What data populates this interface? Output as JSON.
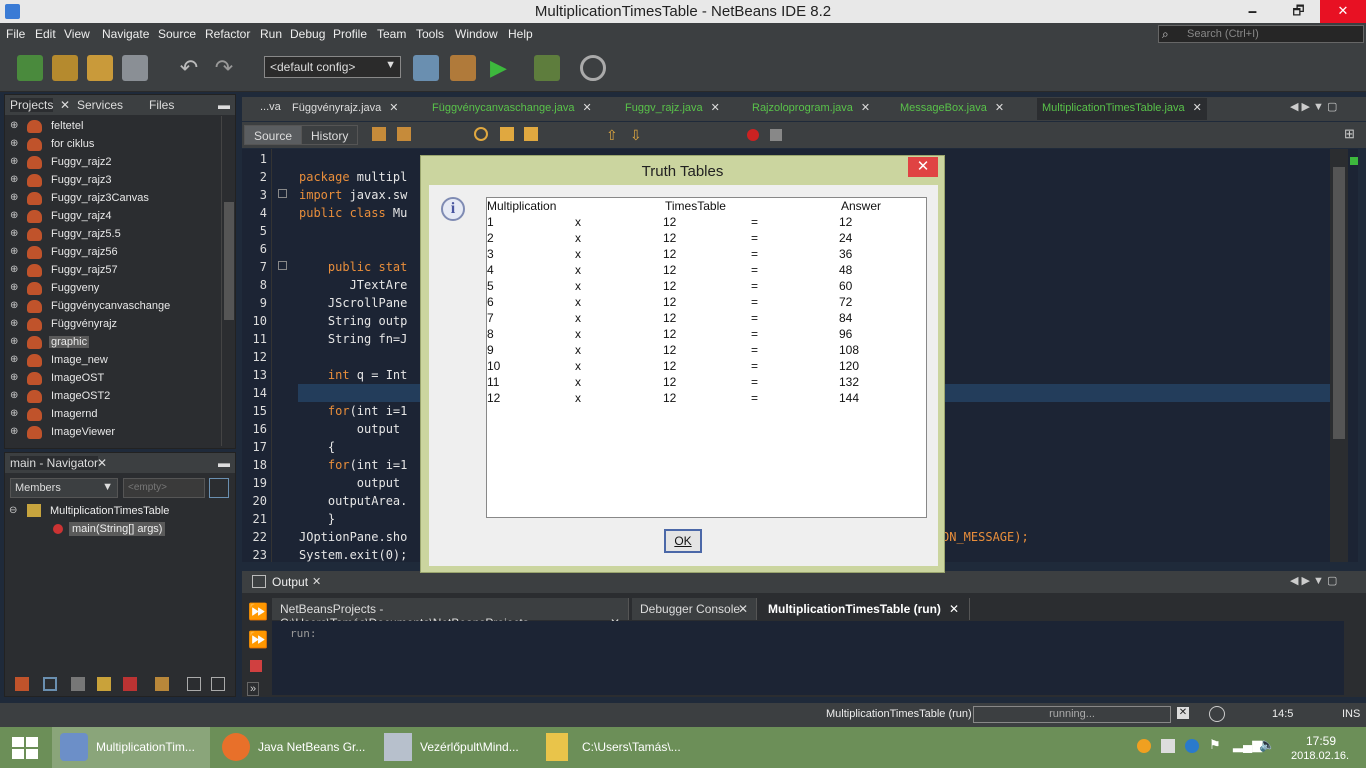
{
  "window": {
    "title": "MultiplicationTimesTable - NetBeans IDE 8.2",
    "minimize": "🗕",
    "maximize": "🗗",
    "close": "✕"
  },
  "menu": [
    "File",
    "Edit",
    "View",
    "Navigate",
    "Source",
    "Refactor",
    "Run",
    "Debug",
    "Profile",
    "Team",
    "Tools",
    "Window",
    "Help"
  ],
  "search": {
    "placeholder": "Search (Ctrl+I)"
  },
  "toolbar": {
    "config": "<default config>"
  },
  "projects_panel": {
    "tabs": [
      "Projects",
      "Services",
      "Files"
    ],
    "items": [
      "feltetel",
      "for ciklus",
      "Fuggv_rajz2",
      "Fuggv_rajz3",
      "Fuggv_rajz3Canvas",
      "Fuggv_rajz4",
      "Fuggv_rajz5.5",
      "Fuggv_rajz56",
      "Fuggv_rajz57",
      "Fuggveny",
      "Függvénycanvaschange",
      "Függvényrajz",
      "graphic",
      "Image_new",
      "ImageOST",
      "ImageOST2",
      "Imagernd",
      "ImageViewer"
    ],
    "selected": "graphic"
  },
  "navigator": {
    "title": "main - Navigator",
    "members": "Members",
    "empty": "<empty>",
    "class_name": "MultiplicationTimesTable",
    "method": "main(String[] args)"
  },
  "editor": {
    "tabs": [
      "...va",
      "Függvényrajz.java",
      "Függvénycanvaschange.java",
      "Fuggv_rajz.java",
      "Rajzoloprogram.java",
      "MessageBox.java",
      "MultiplicationTimesTable.java"
    ],
    "active_tab": "MultiplicationTimesTable.java",
    "sub_tabs": [
      "Source",
      "History"
    ],
    "lines": [
      {
        "n": "1",
        "kw": "",
        "text": ""
      },
      {
        "n": "2",
        "kw": "package",
        "text": " multipl"
      },
      {
        "n": "3",
        "kw": "import",
        "text": " javax.sw"
      },
      {
        "n": "4",
        "kw": "public class",
        "text": " Mu"
      },
      {
        "n": "5",
        "kw": "",
        "text": ""
      },
      {
        "n": "6",
        "kw": "",
        "text": ""
      },
      {
        "n": "7",
        "kw": "    public stat",
        "text": ""
      },
      {
        "n": "8",
        "kw": "",
        "text": "       JTextAre"
      },
      {
        "n": "9",
        "kw": "",
        "text": "    JScrollPane"
      },
      {
        "n": "10",
        "kw": "",
        "text": "    String outp"
      },
      {
        "n": "11",
        "kw": "",
        "text": "    String fn=J"
      },
      {
        "n": "12",
        "kw": "",
        "text": ""
      },
      {
        "n": "13",
        "kw": "    int",
        "text": " q = Int"
      },
      {
        "n": "14",
        "kw": "",
        "text": ""
      },
      {
        "n": "15",
        "kw": "    for",
        "text": "(int i=1"
      },
      {
        "n": "16",
        "kw": "",
        "text": "        output"
      },
      {
        "n": "17",
        "kw": "",
        "text": "    {"
      },
      {
        "n": "18",
        "kw": "    for",
        "text": "(int i=1"
      },
      {
        "n": "19",
        "kw": "",
        "text": "        output"
      },
      {
        "n": "20",
        "kw": "",
        "text": "    outputArea."
      },
      {
        "n": "21",
        "kw": "",
        "text": "    }"
      },
      {
        "n": "22",
        "kw": "",
        "text": "JOptionPane.sho"
      },
      {
        "n": "23",
        "kw": "",
        "text": "System.exit(0);"
      }
    ],
    "line22_tail": "ON_MESSAGE);"
  },
  "output": {
    "title": "Output",
    "tabs": [
      "NetBeansProjects - C:\\Users\\Tamás\\Documents\\NetBeansProjects",
      "Debugger Console",
      "MultiplicationTimesTable (run)"
    ],
    "text": "run:"
  },
  "status": {
    "task": "MultiplicationTimesTable (run)",
    "progress": "running...",
    "position": "14:5",
    "mode": "INS"
  },
  "taskbar": {
    "items": [
      "MultiplicationTim...",
      "Java NetBeans Gr...",
      "Vezérlőpult\\Mind...",
      "C:\\Users\\Tamás\\..."
    ],
    "time": "17:59",
    "date": "2018.02.16."
  },
  "dialog": {
    "title": "Truth Tables",
    "headers": [
      "Multiplication",
      "TimesTable",
      "Answer"
    ],
    "rows": [
      [
        "1",
        "x",
        "12",
        "=",
        "12"
      ],
      [
        "2",
        "x",
        "12",
        "=",
        "24"
      ],
      [
        "3",
        "x",
        "12",
        "=",
        "36"
      ],
      [
        "4",
        "x",
        "12",
        "=",
        "48"
      ],
      [
        "5",
        "x",
        "12",
        "=",
        "60"
      ],
      [
        "6",
        "x",
        "12",
        "=",
        "72"
      ],
      [
        "7",
        "x",
        "12",
        "=",
        "84"
      ],
      [
        "8",
        "x",
        "12",
        "=",
        "96"
      ],
      [
        "9",
        "x",
        "12",
        "=",
        "108"
      ],
      [
        "10",
        "x",
        "12",
        "=",
        "120"
      ],
      [
        "11",
        "x",
        "12",
        "=",
        "132"
      ],
      [
        "12",
        "x",
        "12",
        "=",
        "144"
      ]
    ],
    "ok": "OK"
  },
  "colors": {
    "accent": "#59c24a",
    "keyword": "#e98e3b",
    "dialog_frame": "#cbd59f",
    "taskbar": "#6c8f58"
  }
}
